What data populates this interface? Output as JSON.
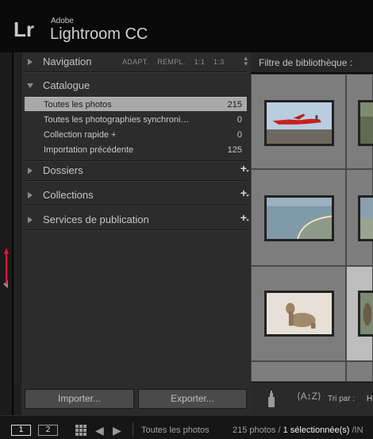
{
  "identity": {
    "logo": "Lr",
    "brand_small": "Adobe",
    "brand_name": "Lightroom CC"
  },
  "annotation": {
    "label": "1",
    "color": "#e4163a"
  },
  "left_panel": {
    "navigation": {
      "title": "Navigation",
      "presets": [
        "ADAPT.",
        "REMPL.",
        "1:1",
        "1:3"
      ]
    },
    "catalog": {
      "title": "Catalogue",
      "items": [
        {
          "label": "Toutes les photos",
          "count": "215",
          "selected": true
        },
        {
          "label": "Toutes les photographies synchroni…",
          "count": "0"
        },
        {
          "label": "Collection rapide +",
          "count": "0"
        },
        {
          "label": "Importation précédente",
          "count": "125"
        }
      ]
    },
    "sections": [
      {
        "title": "Dossiers"
      },
      {
        "title": "Collections"
      },
      {
        "title": "Services de publication"
      }
    ],
    "import_button": "Importer...",
    "export_button": "Exporter..."
  },
  "library": {
    "filter_label": "Filtre de bibliothèque :",
    "sort_label": "Tri par :",
    "sort_value": "H"
  },
  "bottom_bar": {
    "page1": "1",
    "page2": "2",
    "source": "Toutes les photos",
    "count_text": "215 photos /",
    "selected_text": "1 sélectionnée(s)",
    "trail_text": " /IN"
  }
}
